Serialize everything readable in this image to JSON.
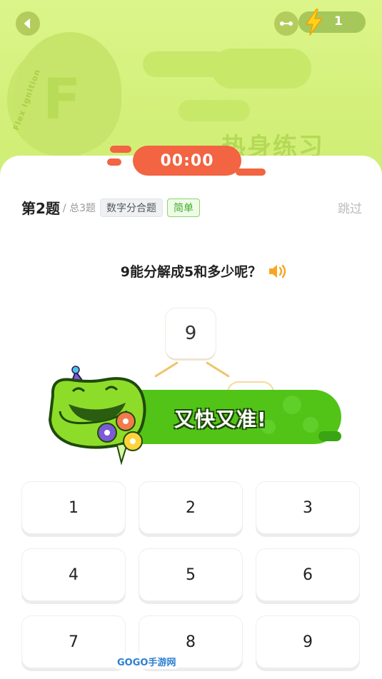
{
  "header": {
    "energy_count": "1",
    "timer": "00:00",
    "bg_brand_text": "Flex Ignition",
    "bg_title": "热身练习"
  },
  "question": {
    "number": "第2题",
    "total": "/ 总3题",
    "type_tag": "数字分合题",
    "level_tag": "简单",
    "skip_label": "跳过",
    "prompt": "9能分解成5和多少呢？",
    "root_value": "9"
  },
  "feedback": {
    "banner_text": "又快又准!"
  },
  "keypad": {
    "keys": [
      "1",
      "2",
      "3",
      "4",
      "5",
      "6",
      "7",
      "8",
      "9"
    ]
  },
  "watermark": "GOGO手游网",
  "colors": {
    "accent_orange": "#f26442",
    "green": "#52c418",
    "hero_bg": "#d3f07a"
  }
}
